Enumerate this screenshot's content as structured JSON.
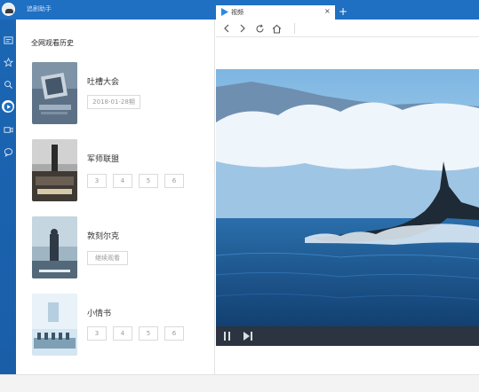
{
  "app": {
    "title": "追剧助手"
  },
  "history": {
    "title": "全网观看历史",
    "items": [
      {
        "title": "吐槽大会",
        "tag": "2018-01-28期"
      },
      {
        "title": "军师联盟",
        "episodes": [
          "3",
          "4",
          "5",
          "6"
        ]
      },
      {
        "title": "敦刻尔克",
        "tag": "继续观看"
      },
      {
        "title": "小情书",
        "episodes": [
          "3",
          "4",
          "5",
          "6"
        ]
      }
    ]
  },
  "browser": {
    "tab_label": "视频",
    "tab_close": "×",
    "new_tab": "+"
  },
  "nav_icons": [
    "list-icon",
    "star-icon",
    "search-icon",
    "play-icon",
    "video-camera-icon",
    "chat-icon"
  ],
  "colors": {
    "brand_blue": "#1f6fc2",
    "control_bar": "#2b3440",
    "sea": "#1d5f9c",
    "sky": "#8dc3ea"
  }
}
